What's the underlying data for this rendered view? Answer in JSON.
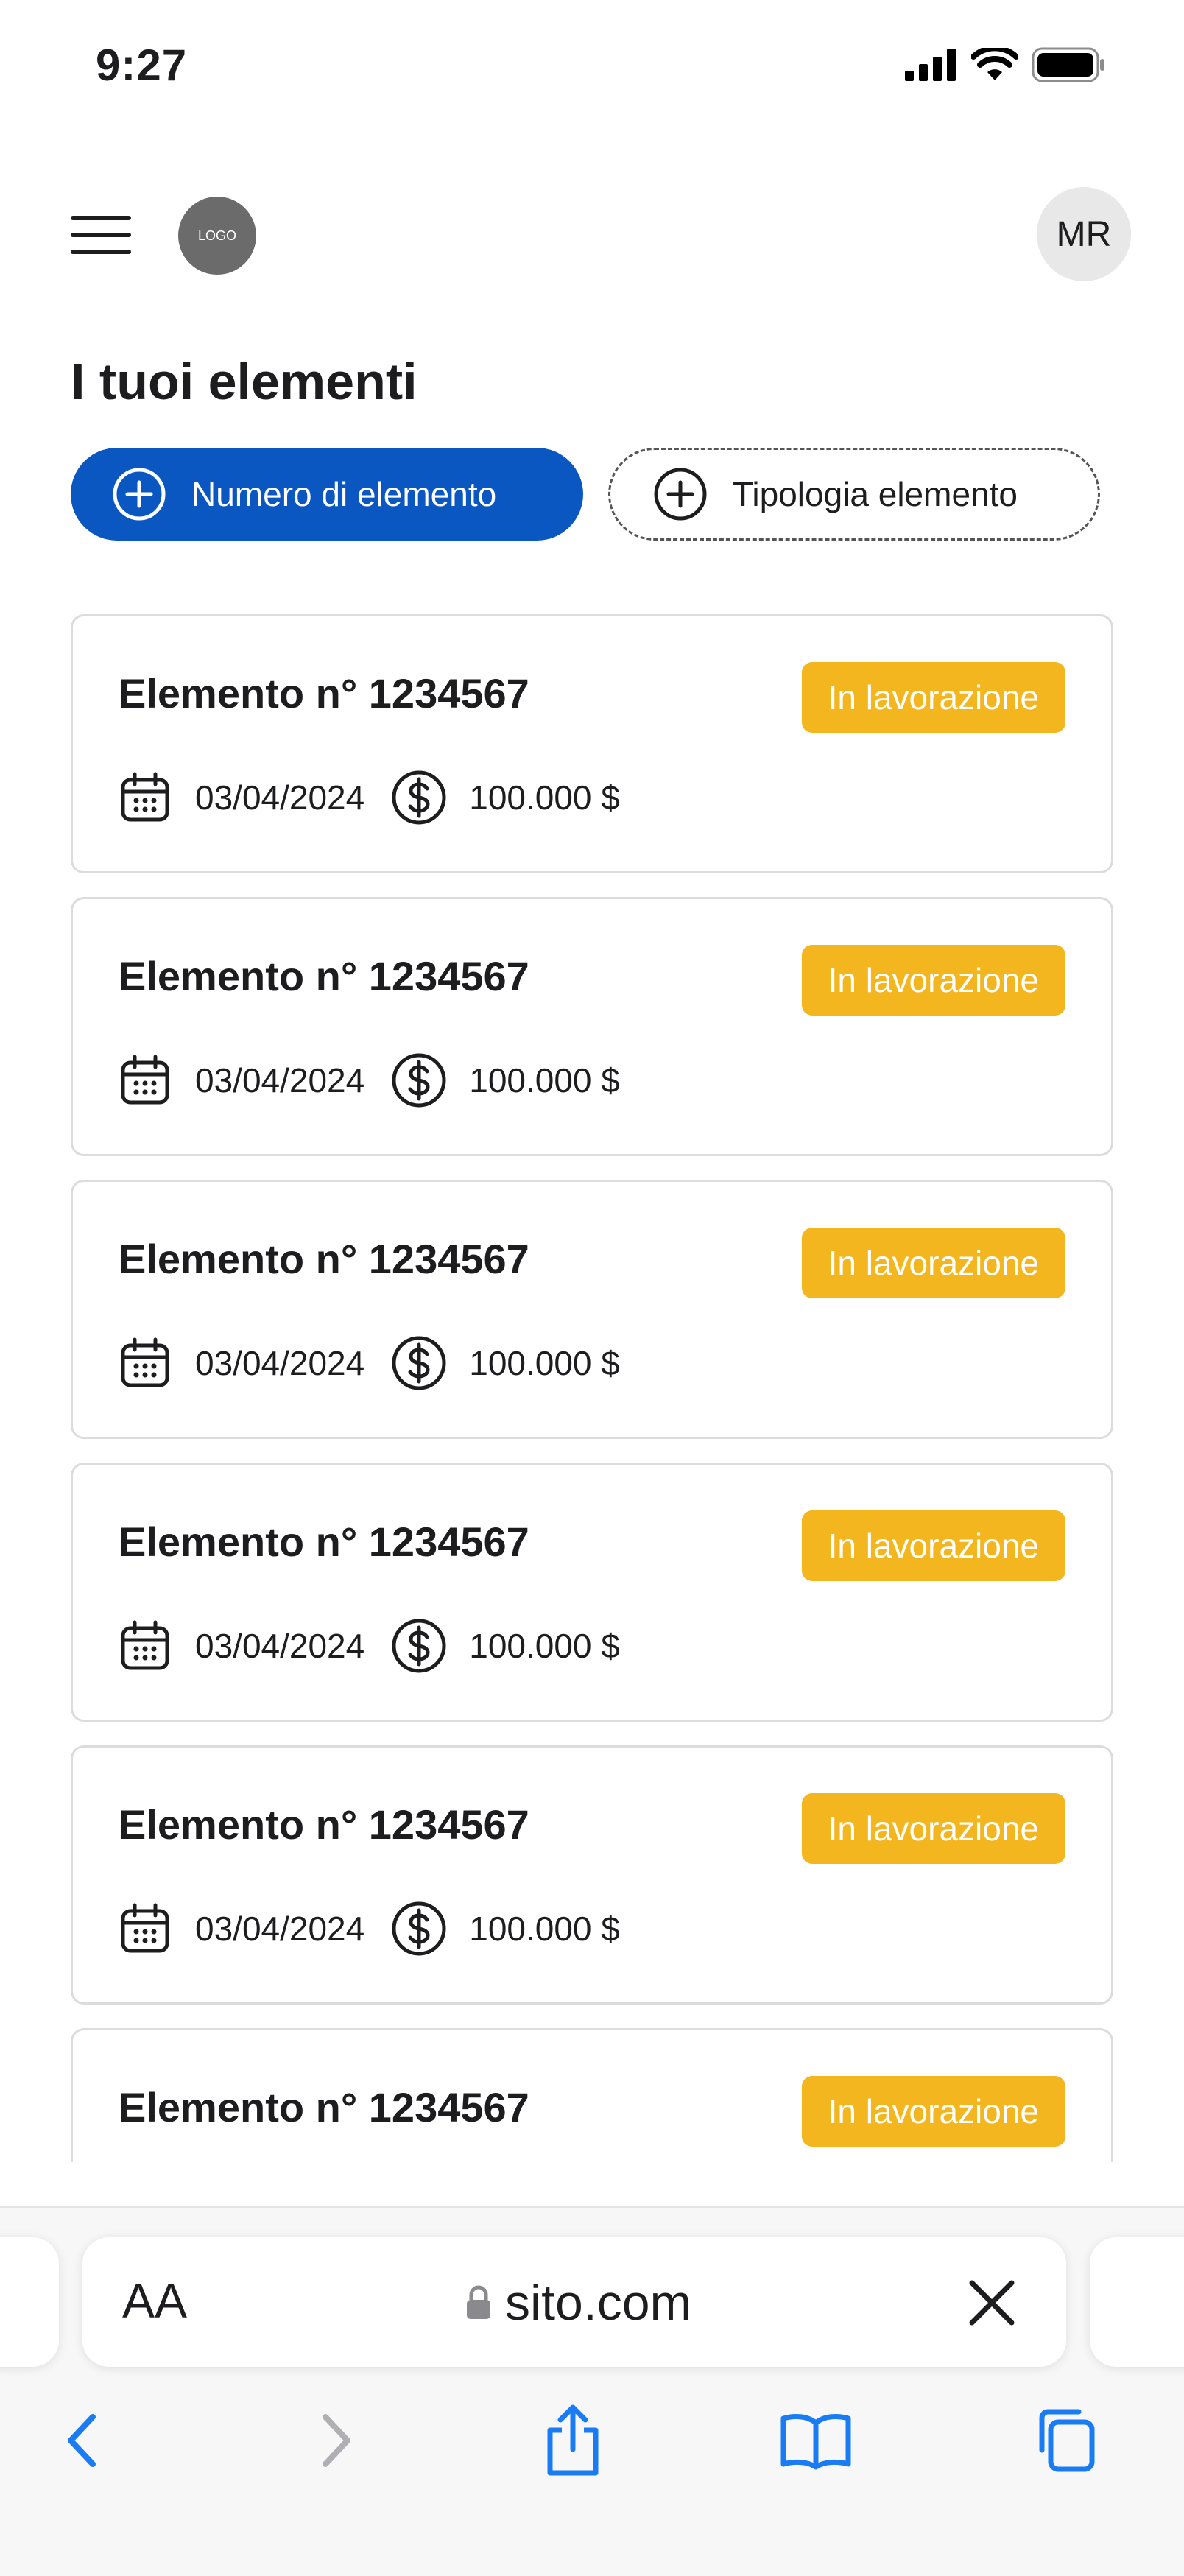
{
  "status_bar": {
    "time": "9:27"
  },
  "header": {
    "logo_text": "LOGO",
    "avatar_initials": "MR"
  },
  "page": {
    "title": "I tuoi elementi"
  },
  "filters": {
    "primary_label": "Numero di elemento",
    "secondary_label": "Tipologia elemento"
  },
  "items": [
    {
      "title": "Elemento n° 1234567",
      "status": "In lavorazione",
      "date": "03/04/2024",
      "amount": "100.000 $"
    },
    {
      "title": "Elemento n° 1234567",
      "status": "In lavorazione",
      "date": "03/04/2024",
      "amount": "100.000 $"
    },
    {
      "title": "Elemento n° 1234567",
      "status": "In lavorazione",
      "date": "03/04/2024",
      "amount": "100.000 $"
    },
    {
      "title": "Elemento n° 1234567",
      "status": "In lavorazione",
      "date": "03/04/2024",
      "amount": "100.000 $"
    },
    {
      "title": "Elemento n° 1234567",
      "status": "In lavorazione",
      "date": "03/04/2024",
      "amount": "100.000 $"
    },
    {
      "title": "Elemento n° 1234567",
      "status": "In lavorazione",
      "date": "",
      "amount": ""
    }
  ],
  "browser": {
    "text_size_label": "AA",
    "url": "sito.com"
  },
  "colors": {
    "primary": "#0b57c2",
    "badge": "#f3b61f",
    "ios_blue": "#1a7cf5"
  },
  "icons": [
    "signal-icon",
    "wifi-icon",
    "battery-icon",
    "menu-icon",
    "plus-circle-icon",
    "calendar-icon",
    "dollar-icon",
    "lock-icon",
    "close-icon",
    "back-icon",
    "forward-icon",
    "share-icon",
    "bookmarks-icon",
    "tabs-icon"
  ]
}
